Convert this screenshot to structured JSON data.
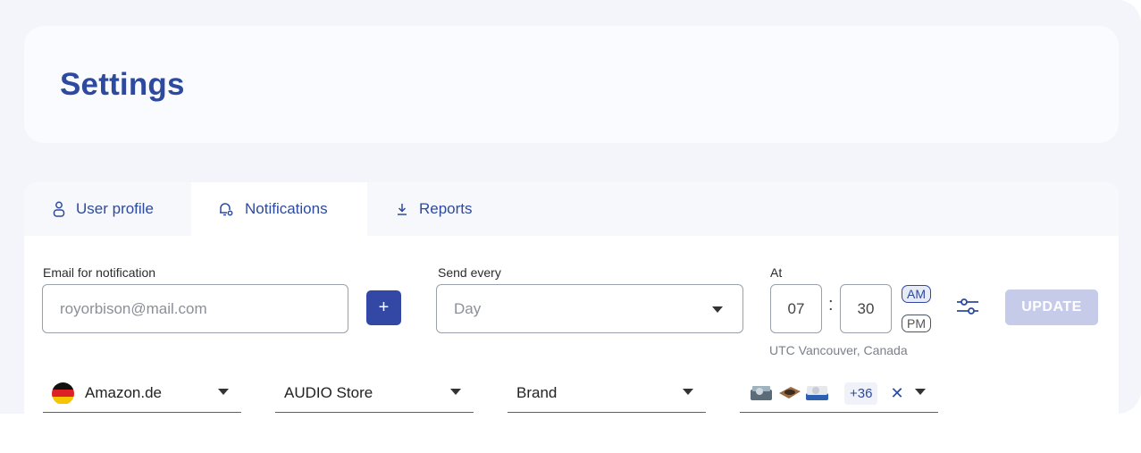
{
  "page": {
    "title": "Settings"
  },
  "tabs": [
    {
      "label": "User profile",
      "icon": "user-icon"
    },
    {
      "label": "Notifications",
      "icon": "bell-gear-icon",
      "active": true
    },
    {
      "label": "Reports",
      "icon": "download-icon"
    }
  ],
  "email": {
    "label": "Email for notification",
    "placeholder": "royorbison@mail.com",
    "add_label": "+"
  },
  "send_every": {
    "label": "Send every",
    "value": "Day"
  },
  "at": {
    "label": "At",
    "hour": "07",
    "separator": ":",
    "minute": "30",
    "am": "AM",
    "pm": "PM",
    "selected": "AM",
    "timezone": "UTC Vancouver, Canada"
  },
  "update_label": "UPDATE",
  "filters": {
    "marketplace": "Amazon.de",
    "store": "AUDIO Store",
    "brand": "Brand",
    "products_more": "+36",
    "clear": "✕"
  },
  "colors": {
    "accent": "#2e4a9e",
    "primary_button": "#3347a5",
    "disabled_button": "#c6cbea"
  }
}
